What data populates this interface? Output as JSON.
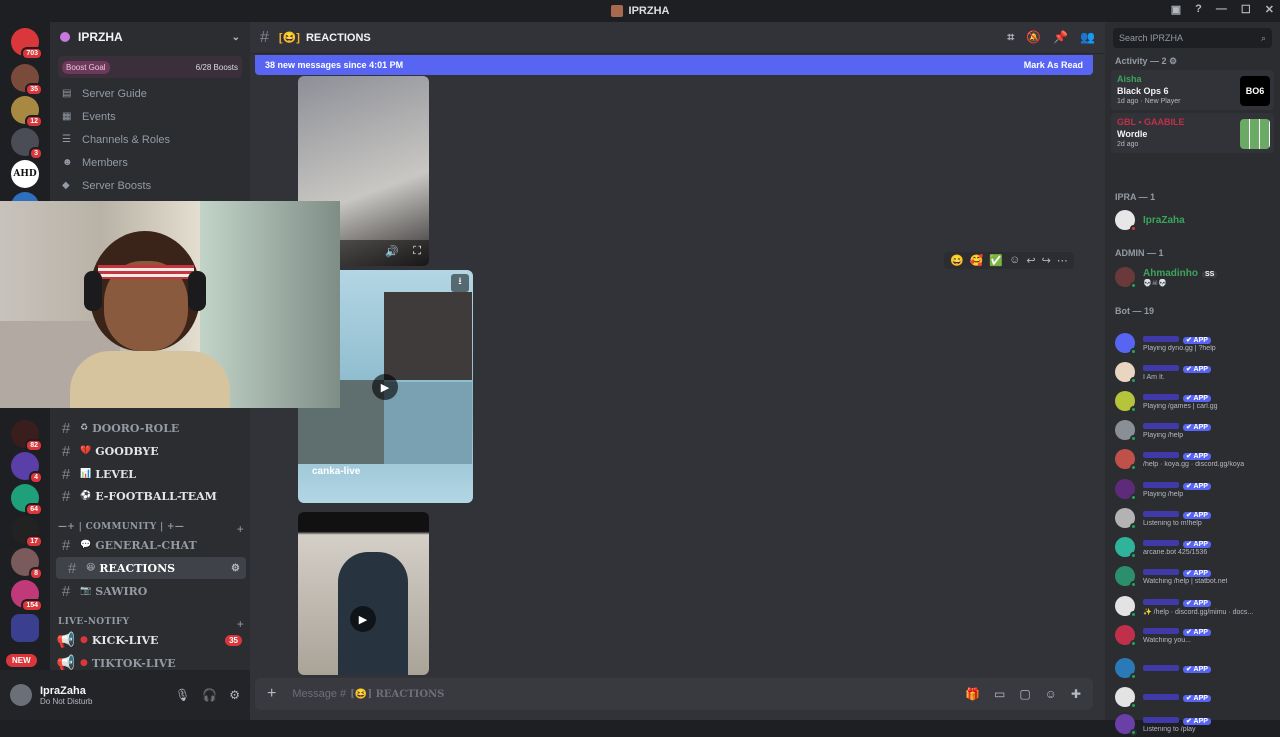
{
  "window": {
    "title": "IPRZHA"
  },
  "servers": [
    {
      "badge": "703"
    },
    {
      "badge": "35"
    },
    {
      "badge": "12"
    },
    {
      "badge": "3"
    },
    {
      "label": "AHD"
    },
    {
      "badge": ""
    },
    {
      "badge": "82"
    },
    {
      "badge": "4"
    },
    {
      "badge": "64"
    },
    {
      "badge": "17"
    },
    {
      "badge": "8"
    },
    {
      "badge": "154"
    },
    {
      "badge": "NEW"
    }
  ],
  "guild": {
    "name": "IPRZHA",
    "boost_label": "Boost Goal",
    "boost_progress": "6/28 Boosts",
    "nav": [
      "Server Guide",
      "Events",
      "Channels & Roles",
      "Members",
      "Server Boosts"
    ]
  },
  "channels": {
    "list": [
      {
        "name": "DOORO-ROLE",
        "emoji": "♻"
      },
      {
        "name": "GOODBYE",
        "emoji": "💔"
      },
      {
        "name": "LEVEL",
        "emoji": "📊"
      },
      {
        "name": "E-FOOTBALL-TEAM",
        "emoji": "⚽"
      }
    ],
    "community_category": "—+ | COMMUNITY | +—",
    "community": [
      {
        "name": "GENERAL-CHAT",
        "emoji": "💬"
      },
      {
        "name": "REACTIONS",
        "emoji": "😆"
      },
      {
        "name": "SAWIRO",
        "emoji": "📷"
      }
    ],
    "live_category": "LIVE-NOTIFY",
    "live": [
      {
        "name": "KICK-LIVE",
        "count": "35"
      },
      {
        "name": "TIKTOK-LIVE",
        "count": ""
      }
    ]
  },
  "user": {
    "name": "IpraZaha",
    "status": "Do Not Disturb"
  },
  "main": {
    "channel": "REACTIONS",
    "new_messages": "38 new messages since 4:01 PM",
    "mark_as_read": "Mark As Read",
    "video_caption": "canka-live",
    "composer_placeholder": "Message #",
    "composer_channel": "REACTIONS"
  },
  "members": {
    "search_placeholder": "Search IPRZHA",
    "activity_header": "Activity — 2",
    "activities": [
      {
        "user": "Aisha",
        "game": "Black Ops 6",
        "meta": "1d ago · New Player",
        "user_color": "#3ba55d",
        "thumb": "BO6"
      },
      {
        "user": "GBL • GAABILE",
        "game": "Wordle",
        "meta": "2d ago",
        "user_color": "#c0304a",
        "thumb": ""
      }
    ],
    "ipra_header": "IPRA — 1",
    "ipra": [
      {
        "name": "IpraZaha",
        "color": "#3ba55d"
      }
    ],
    "admin_header": "ADMIN — 1",
    "admin": [
      {
        "name": "Ahmadinho",
        "tag": "SS",
        "sub": "💀☠💀",
        "color": "#3ba55d"
      }
    ],
    "bot_header": "Bot — 19",
    "bots": [
      {
        "sub": "Playing dyno.gg | ?help"
      },
      {
        "sub": "I Am It."
      },
      {
        "sub": "Playing /games | carl.gg"
      },
      {
        "sub": "Playing /help"
      },
      {
        "sub": "/help · koya.gg · discord.gg/koya"
      },
      {
        "sub": "Playing /help"
      },
      {
        "sub": "Listening to m!help"
      },
      {
        "sub": "arcane.bot 425/1536"
      },
      {
        "sub": "Watching /help | statbot.net"
      },
      {
        "sub": "✨ /help · discord.gg/mimu · docs..."
      },
      {
        "sub": "Watching you..."
      },
      {
        "sub": ""
      },
      {
        "sub": ""
      },
      {
        "sub": "Listening to /play"
      }
    ],
    "app_tag": "✔ APP"
  }
}
